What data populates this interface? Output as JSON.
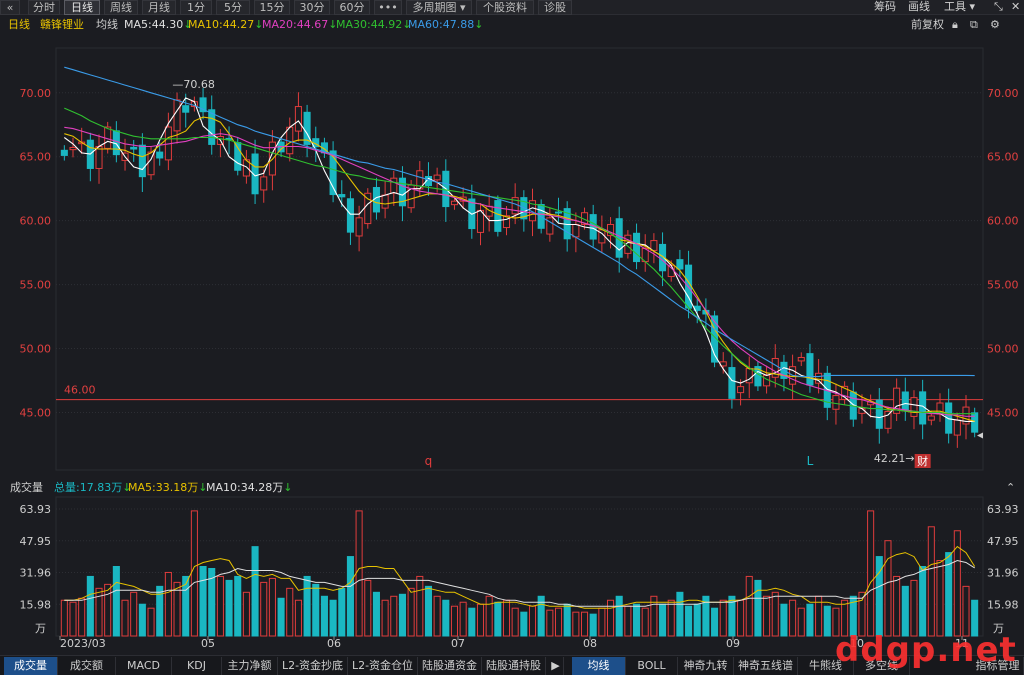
{
  "toolbar": {
    "collapse_icon": "double-chevron-left-icon",
    "periods": [
      "分时",
      "日线",
      "周线",
      "月线",
      "1分",
      "5分",
      "15分",
      "30分",
      "60分"
    ],
    "active_period": "日线",
    "more_label": "•••",
    "multi_period_label": "多周期图",
    "stock_info_label": "个股资料",
    "diagnose_label": "诊股",
    "right": [
      "筹码",
      "画线",
      "工具"
    ],
    "window_icons": [
      "shrink-icon",
      "close-icon"
    ]
  },
  "legend": {
    "period": "日线",
    "stock_name": "赣锋锂业",
    "ma_label": "均线",
    "items": [
      {
        "text": "MA5:44.30",
        "color": "#e0e0e0",
        "arrow": "↓"
      },
      {
        "text": "MA10:44.27",
        "color": "#e8c200",
        "arrow": "↓"
      },
      {
        "text": "MA20:44.67",
        "color": "#e040c0",
        "arrow": "↓"
      },
      {
        "text": "MA30:44.92",
        "color": "#30c030",
        "arrow": "↓"
      },
      {
        "text": "MA60:47.88",
        "color": "#3a9be8",
        "arrow": "↓"
      }
    ],
    "adjust_label": "前复权",
    "right_icons": [
      "lock-icon",
      "restore-icon",
      "settings-icon"
    ]
  },
  "colors": {
    "up": "#e03c3c",
    "down": "#1ab7c2",
    "price_axis": "#e04040",
    "grid": "#2d2e34",
    "hline": "#e03c3c"
  },
  "chart_data": [
    {
      "type": "candlestick",
      "title": "赣锋锂业 日线",
      "y_ticks": [
        "70.00",
        "65.00",
        "60.00",
        "55.00",
        "50.00",
        "45.00"
      ],
      "ylim": [
        40.5,
        73.5
      ],
      "x_ticks": [
        "2023/03",
        "05",
        "06",
        "07",
        "08",
        "09",
        "10",
        "11"
      ],
      "annotations": {
        "high": "70.68",
        "low": "42.21",
        "hline": "46.00",
        "hline_value": 46.0
      },
      "markers": [
        {
          "label": "q",
          "color": "#e03c3c"
        },
        {
          "label": "L",
          "color": "#1ab7c2"
        },
        {
          "label": "财",
          "color": "#ffffff",
          "bg": "#c03030"
        }
      ],
      "ma_series": [
        {
          "name": "MA5",
          "color": "#ffffff",
          "values": [
            66.5,
            66.0,
            65.3,
            65.2,
            65.8,
            66.2,
            66.0,
            65.0,
            64.2,
            64.0,
            64.8,
            66.3,
            67.6,
            68.6,
            69.6,
            69.3,
            67.4,
            66.8,
            66.3,
            65.0,
            64.5,
            64.2,
            63.5,
            63.7,
            65.3,
            66.5,
            67.3,
            67.8,
            66.8,
            65.5,
            63.9,
            62.6,
            61.3,
            60.5,
            60.5,
            61.3,
            61.8,
            62.0,
            62.2,
            62.0,
            62.5,
            62.5,
            63.3,
            63.0,
            62.5,
            61.8,
            61.0,
            60.5,
            60.8,
            60.0,
            60.0,
            60.1,
            60.4,
            60.7,
            61.0,
            60.8,
            60.5,
            59.8,
            59.7,
            59.7,
            59.5,
            59.4,
            59.0,
            58.3,
            57.7,
            58.3,
            58.2,
            58.1,
            57.6,
            57.2,
            56.5,
            55.1,
            54.0,
            52.7,
            51.3,
            49.5,
            48.4,
            47.5,
            47.3,
            47.6,
            48.2,
            47.9,
            48.1,
            48.5,
            48.3,
            47.9,
            47.7,
            47.5,
            46.8,
            46.6,
            46.2,
            45.6,
            45.3,
            44.7,
            44.6,
            44.8,
            45.5,
            45.7,
            45.6,
            45.5,
            45.0,
            44.9,
            44.5,
            44.4,
            44.3,
            44.3
          ]
        },
        {
          "name": "MA10",
          "color": "#e8c200",
          "values": [
            66.8,
            66.6,
            66.1,
            65.7,
            65.6,
            65.6,
            65.6,
            65.5,
            65.2,
            65.0,
            65.3,
            65.9,
            66.5,
            66.7,
            67.0,
            67.8,
            68.1,
            68.0,
            67.7,
            66.8,
            65.7,
            64.7,
            64.2,
            64.2,
            64.8,
            65.6,
            66.1,
            66.3,
            66.3,
            66.0,
            65.6,
            65.0,
            64.1,
            63.2,
            62.3,
            61.7,
            61.4,
            61.3,
            61.4,
            61.5,
            61.7,
            61.9,
            62.1,
            62.1,
            62.0,
            61.9,
            61.7,
            61.4,
            61.3,
            60.8,
            60.5,
            60.3,
            60.2,
            60.3,
            60.5,
            60.5,
            60.5,
            60.4,
            60.2,
            60.0,
            59.8,
            59.6,
            59.3,
            59.0,
            58.5,
            58.4,
            58.2,
            58.0,
            57.6,
            57.2,
            56.7,
            56.1,
            55.2,
            54.1,
            52.9,
            51.5,
            50.5,
            49.6,
            48.9,
            48.4,
            48.4,
            48.1,
            48.0,
            47.9,
            47.8,
            47.8,
            47.7,
            47.6,
            47.5,
            47.2,
            46.9,
            46.6,
            46.2,
            45.9,
            45.6,
            45.3,
            45.2,
            45.1,
            45.0,
            45.0,
            45.1,
            45.1,
            44.9,
            44.7,
            44.5,
            44.3
          ]
        },
        {
          "name": "MA20",
          "color": "#e040c0",
          "values": [
            67.3,
            67.2,
            67.0,
            66.8,
            66.6,
            66.4,
            66.2,
            66.0,
            65.9,
            65.8,
            65.8,
            65.9,
            66.0,
            66.1,
            66.2,
            66.4,
            66.6,
            66.7,
            66.8,
            66.7,
            66.5,
            66.2,
            65.9,
            65.7,
            65.7,
            65.8,
            65.8,
            65.8,
            65.7,
            65.5,
            65.3,
            65.1,
            64.8,
            64.5,
            64.2,
            63.9,
            63.6,
            63.3,
            63.0,
            62.7,
            62.5,
            62.3,
            62.2,
            62.1,
            62.0,
            61.8,
            61.6,
            61.4,
            61.3,
            61.1,
            61.0,
            60.9,
            60.8,
            60.7,
            60.6,
            60.5,
            60.4,
            60.3,
            60.1,
            60.0,
            59.8,
            59.6,
            59.4,
            59.1,
            58.8,
            58.5,
            58.2,
            57.8,
            57.4,
            56.9,
            56.3,
            55.6,
            54.8,
            53.9,
            53.0,
            52.1,
            51.3,
            50.6,
            50.0,
            49.5,
            49.0,
            48.6,
            48.2,
            47.9,
            47.6,
            47.3,
            47.1,
            46.9,
            46.7,
            46.5,
            46.3,
            46.1,
            46.0,
            45.8,
            45.6,
            45.4,
            45.3,
            45.2,
            45.1,
            45.0,
            44.9,
            44.9,
            44.8,
            44.8,
            44.7,
            44.7
          ]
        },
        {
          "name": "MA30",
          "color": "#30c030",
          "values": [
            68.8,
            68.5,
            68.2,
            67.8,
            67.5,
            67.2,
            67.0,
            66.8,
            66.6,
            66.5,
            66.4,
            66.4,
            66.4,
            66.4,
            66.4,
            66.5,
            66.5,
            66.5,
            66.4,
            66.3,
            66.1,
            65.9,
            65.7,
            65.5,
            65.3,
            65.1,
            64.9,
            64.7,
            64.5,
            64.3,
            64.2,
            64.0,
            63.8,
            63.6,
            63.5,
            63.3,
            63.2,
            63.1,
            63.0,
            62.9,
            62.8,
            62.7,
            62.6,
            62.5,
            62.4,
            62.3,
            62.2,
            62.1,
            62.0,
            61.9,
            61.8,
            61.7,
            61.6,
            61.5,
            61.3,
            61.2,
            61.0,
            60.8,
            60.6,
            60.4,
            60.1,
            59.8,
            59.4,
            59.0,
            58.5,
            58.0,
            57.4,
            56.8,
            56.2,
            55.5,
            54.8,
            54.0,
            53.2,
            52.4,
            51.6,
            50.9,
            50.2,
            49.6,
            49.0,
            48.5,
            48.0,
            47.6,
            47.3,
            47.0,
            46.7,
            46.4,
            46.2,
            46.0,
            45.8,
            45.7,
            45.6,
            45.5,
            45.4,
            45.3,
            45.3,
            45.2,
            45.2,
            45.1,
            45.1,
            45.0,
            45.0,
            45.0,
            44.9,
            44.9,
            44.9,
            44.9
          ]
        },
        {
          "name": "MA60",
          "color": "#3a9be8",
          "values": [
            72.0,
            71.8,
            71.6,
            71.4,
            71.2,
            71.0,
            70.8,
            70.6,
            70.4,
            70.2,
            70.0,
            69.8,
            69.6,
            69.4,
            69.2,
            69.0,
            68.7,
            68.4,
            68.1,
            67.8,
            67.5,
            67.3,
            67.0,
            66.8,
            66.6,
            66.4,
            66.2,
            66.0,
            65.8,
            65.6,
            65.4,
            65.2,
            65.0,
            64.8,
            64.6,
            64.5,
            64.3,
            64.1,
            64.0,
            63.8,
            63.6,
            63.4,
            63.2,
            63.0,
            62.9,
            62.7,
            62.5,
            62.3,
            62.1,
            61.9,
            61.7,
            61.5,
            61.3,
            61.0,
            60.7,
            60.3,
            59.9,
            59.5,
            59.1,
            58.7,
            58.3,
            57.9,
            57.5,
            57.1,
            56.7,
            56.2,
            55.8,
            55.3,
            54.8,
            54.3,
            53.8,
            53.3,
            52.9,
            52.4,
            52.0,
            51.5,
            51.1,
            50.7,
            50.3,
            49.9,
            49.5,
            49.1,
            48.7,
            48.3,
            47.9,
            47.8,
            47.8,
            47.8,
            47.9,
            47.9,
            47.9,
            47.9,
            47.9,
            47.9,
            47.9,
            47.9,
            47.9,
            47.9,
            47.9,
            47.9,
            47.9,
            47.9,
            47.9,
            47.9,
            47.9,
            47.88
          ]
        }
      ]
    },
    {
      "type": "bar",
      "title": "成交量",
      "y_ticks": [
        "63.93",
        "47.95",
        "31.96",
        "15.98"
      ],
      "y_unit": "万",
      "ylim": [
        0,
        70
      ],
      "series": [
        {
          "name": "成交量",
          "values": [
            18,
            17,
            19,
            30,
            24,
            26,
            35,
            18,
            22,
            16,
            14,
            25,
            32,
            27,
            30,
            63,
            35,
            34,
            30,
            28,
            30,
            22,
            45,
            27,
            29,
            19,
            24,
            18,
            30,
            26,
            20,
            18,
            24,
            40,
            63,
            28,
            22,
            18,
            20,
            21,
            24,
            30,
            25,
            20,
            18,
            15,
            17,
            14,
            16,
            20,
            17,
            18,
            14,
            12,
            15,
            20,
            13,
            14,
            16,
            12,
            12,
            11,
            14,
            18,
            20,
            15,
            16,
            14,
            20,
            16,
            18,
            22,
            15,
            16,
            20,
            14,
            18,
            20,
            18,
            30,
            28,
            20,
            22,
            16,
            18,
            14,
            16,
            20,
            15,
            14,
            18,
            20,
            22,
            63,
            40,
            48,
            30,
            25,
            28,
            35,
            55,
            38,
            42,
            53,
            25,
            18
          ]
        },
        {
          "name": "MA5",
          "values": [
            18,
            18,
            19,
            21,
            22,
            23,
            27,
            26,
            25,
            23,
            21,
            21,
            22,
            24,
            26,
            35,
            37,
            38,
            39,
            38,
            31,
            29,
            31,
            30,
            31,
            29,
            29,
            23,
            24,
            24,
            24,
            23,
            24,
            27,
            34,
            35,
            35,
            34,
            34,
            28,
            22,
            23,
            24,
            23,
            22,
            22,
            20,
            18,
            16,
            16,
            17,
            17,
            17,
            16,
            15,
            16,
            15,
            15,
            15,
            15,
            14,
            14,
            14,
            14,
            15,
            16,
            17,
            17,
            17,
            17,
            17,
            17,
            18,
            18,
            17,
            17,
            17,
            18,
            18,
            20,
            23,
            23,
            24,
            23,
            21,
            20,
            17,
            17,
            17,
            16,
            16,
            17,
            18,
            27,
            32,
            39,
            41,
            42,
            40,
            33,
            36,
            37,
            40,
            45,
            42,
            35
          ]
        },
        {
          "name": "MA10",
          "values": [
            18,
            18,
            18,
            19,
            20,
            21,
            23,
            23,
            23,
            23,
            22,
            22,
            23,
            23,
            23,
            27,
            28,
            29,
            31,
            32,
            34,
            33,
            33,
            33,
            33,
            32,
            30,
            29,
            28,
            27,
            27,
            26,
            25,
            25,
            28,
            29,
            29,
            29,
            29,
            28,
            28,
            28,
            28,
            27,
            26,
            25,
            24,
            23,
            22,
            21,
            19,
            18,
            18,
            17,
            17,
            17,
            17,
            16,
            16,
            15,
            15,
            15,
            15,
            15,
            15,
            15,
            15,
            15,
            16,
            16,
            16,
            16,
            16,
            16,
            17,
            17,
            17,
            17,
            18,
            19,
            19,
            19,
            20,
            20,
            20,
            20,
            20,
            20,
            20,
            20,
            19,
            19,
            19,
            23,
            25,
            27,
            28,
            30,
            31,
            33,
            34,
            35,
            36,
            38,
            37,
            34.28
          ]
        }
      ]
    }
  ],
  "volume_header": {
    "title": "成交量",
    "total": "总量:17.83万",
    "ma5": "MA5:33.18万",
    "ma10": "MA10:34.28万",
    "total_arrow": "↓",
    "ma5_arrow": "↓",
    "ma10_arrow": "↓",
    "collapse_icon": "chevron-up-icon"
  },
  "bottom_tabs_left": [
    "成交量",
    "成交额",
    "MACD",
    "KDJ",
    "主力净额",
    "L2-资金抄底",
    "L2-资金仓位",
    "陆股通资金",
    "陆股通持股"
  ],
  "bottom_tabs_right": [
    "均线",
    "BOLL",
    "神奇九转",
    "神奇五线谱",
    "牛熊线",
    "多空线",
    "指标管理"
  ],
  "scroll_arrow": "▶",
  "watermark": "ddgp.net"
}
